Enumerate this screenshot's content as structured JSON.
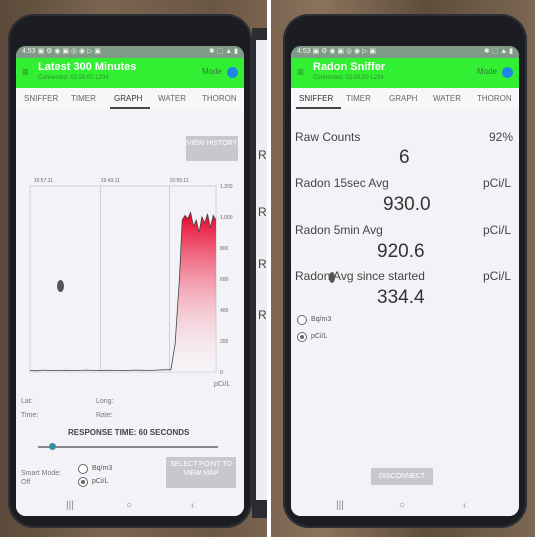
{
  "left": {
    "statusbar": {
      "time": "4:53",
      "icons": "▣ ⚙ ◉ ▣ ◎ ◉ ▷ ▣",
      "right": "✱ ⬚ ▲ ▮"
    },
    "appbar": {
      "title": "Latest 300 Minutes",
      "subtitle": "Connected: 02:50:00 L234",
      "mode": "Mode"
    },
    "tabs": [
      "SNIFFER",
      "TIMER",
      "GRAPH",
      "WATER",
      "THORON"
    ],
    "view_history_button": "VIEW HISTORY",
    "chart_data": {
      "type": "area",
      "x_ticks": [
        "15:57:11",
        "16:43:11",
        "15:55:11"
      ],
      "y_ticks": [
        0,
        200,
        400,
        600,
        800,
        1000,
        1200
      ],
      "ylim": [
        0,
        1200
      ],
      "unit_label": "pCi/L",
      "x": [
        0,
        5,
        10,
        15,
        20,
        25,
        30,
        35,
        40,
        45,
        50,
        55,
        60,
        65,
        70,
        75,
        80,
        85,
        90,
        95,
        100,
        103,
        106,
        108,
        110,
        112,
        114,
        116,
        118,
        120,
        122,
        124,
        126,
        128,
        130,
        132
      ],
      "values": [
        10,
        8,
        12,
        9,
        10,
        11,
        9,
        10,
        12,
        10,
        9,
        11,
        10,
        9,
        10,
        12,
        11,
        10,
        12,
        14,
        15,
        180,
        600,
        980,
        1010,
        990,
        1030,
        940,
        980,
        900,
        1000,
        960,
        1020,
        930,
        1010,
        980
      ],
      "series_color": "#e8002a"
    },
    "lat_label": "Lat:",
    "long_label": "Long:",
    "time_label": "Time:",
    "rate_label": "Rate:",
    "response_time": "RESPONSE TIME: 60 SECONDS",
    "slider_value": 0.03,
    "smart_mode_label": "Smart Mode:",
    "smart_mode_state": "Off",
    "unit_options": [
      "Bq/m3",
      "pCi/L"
    ],
    "selected_unit": "pCi/L",
    "select_point_button": "SELECT POINT TO VIEW MAP",
    "nav": [
      "|||",
      "○",
      "‹"
    ]
  },
  "right": {
    "statusbar": {
      "time": "4:53",
      "icons": "▣ ⚙ ◉ ▣ ◎ ◉ ▷ ▣",
      "right": "✱ ⬚ ▲ ▮"
    },
    "appbar": {
      "title": "Radon Sniffer",
      "subtitle": "Connected: 02:50:00 L234",
      "mode": "Mode"
    },
    "tabs": [
      "SNIFFER",
      "TIMER",
      "GRAPH",
      "WATER",
      "THORON"
    ],
    "raw_counts_label": "Raw Counts",
    "battery_percent": "92%",
    "raw_counts_value": "6",
    "radon_15sec_label": "Radon 15sec Avg",
    "radon_15sec_value": "930.0",
    "radon_15sec_unit": "pCi/L",
    "radon_5min_label": "Radon 5min Avg",
    "radon_5min_value": "920.6",
    "radon_5min_unit": "pCi/L",
    "radon_since_label": "Radon Avg since started",
    "radon_since_value": "334.4",
    "radon_since_unit": "pCi/L",
    "unit_options": [
      "Bq/m3",
      "pCi/L"
    ],
    "selected_unit": "pCi/L",
    "disconnect_button": "DISCONNECT",
    "nav": [
      "|||",
      "○",
      "‹"
    ]
  },
  "colors": {
    "appbar": "#33ef33",
    "accent": "#1e88e5",
    "chart": "#e8002a"
  },
  "middle_partial": {
    "letters": [
      "R",
      "R",
      "R",
      "R"
    ]
  }
}
